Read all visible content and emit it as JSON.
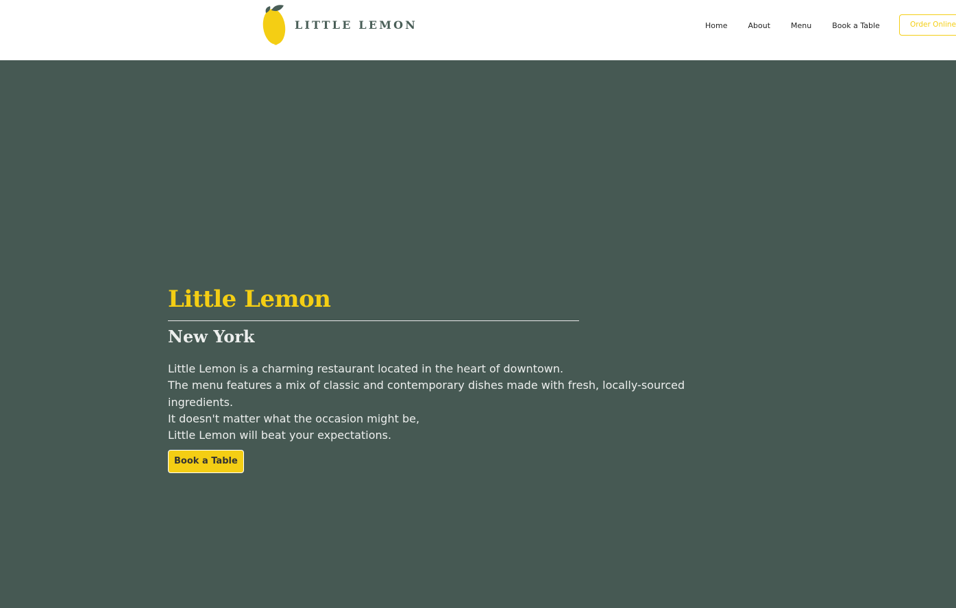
{
  "header": {
    "logo_text": "LITTLE LEMON",
    "nav": [
      {
        "label": "Home"
      },
      {
        "label": "About"
      },
      {
        "label": "Menu"
      },
      {
        "label": "Book a Table"
      }
    ],
    "order_button": "Order Online"
  },
  "hero": {
    "title": "Little Lemon",
    "subtitle": "New York",
    "description": [
      "Little Lemon is a charming restaurant located in the heart of downtown.",
      "The menu features a mix of classic and contemporary dishes made with fresh, locally-sourced ingredients.",
      "It doesn't matter what the occasion might be,",
      "Little Lemon will beat your expectations."
    ],
    "cta_button": "Book a Table"
  },
  "colors": {
    "brand_green": "#465953",
    "brand_yellow": "#f4ce14"
  },
  "icons": {
    "logo": "lemon-icon"
  }
}
